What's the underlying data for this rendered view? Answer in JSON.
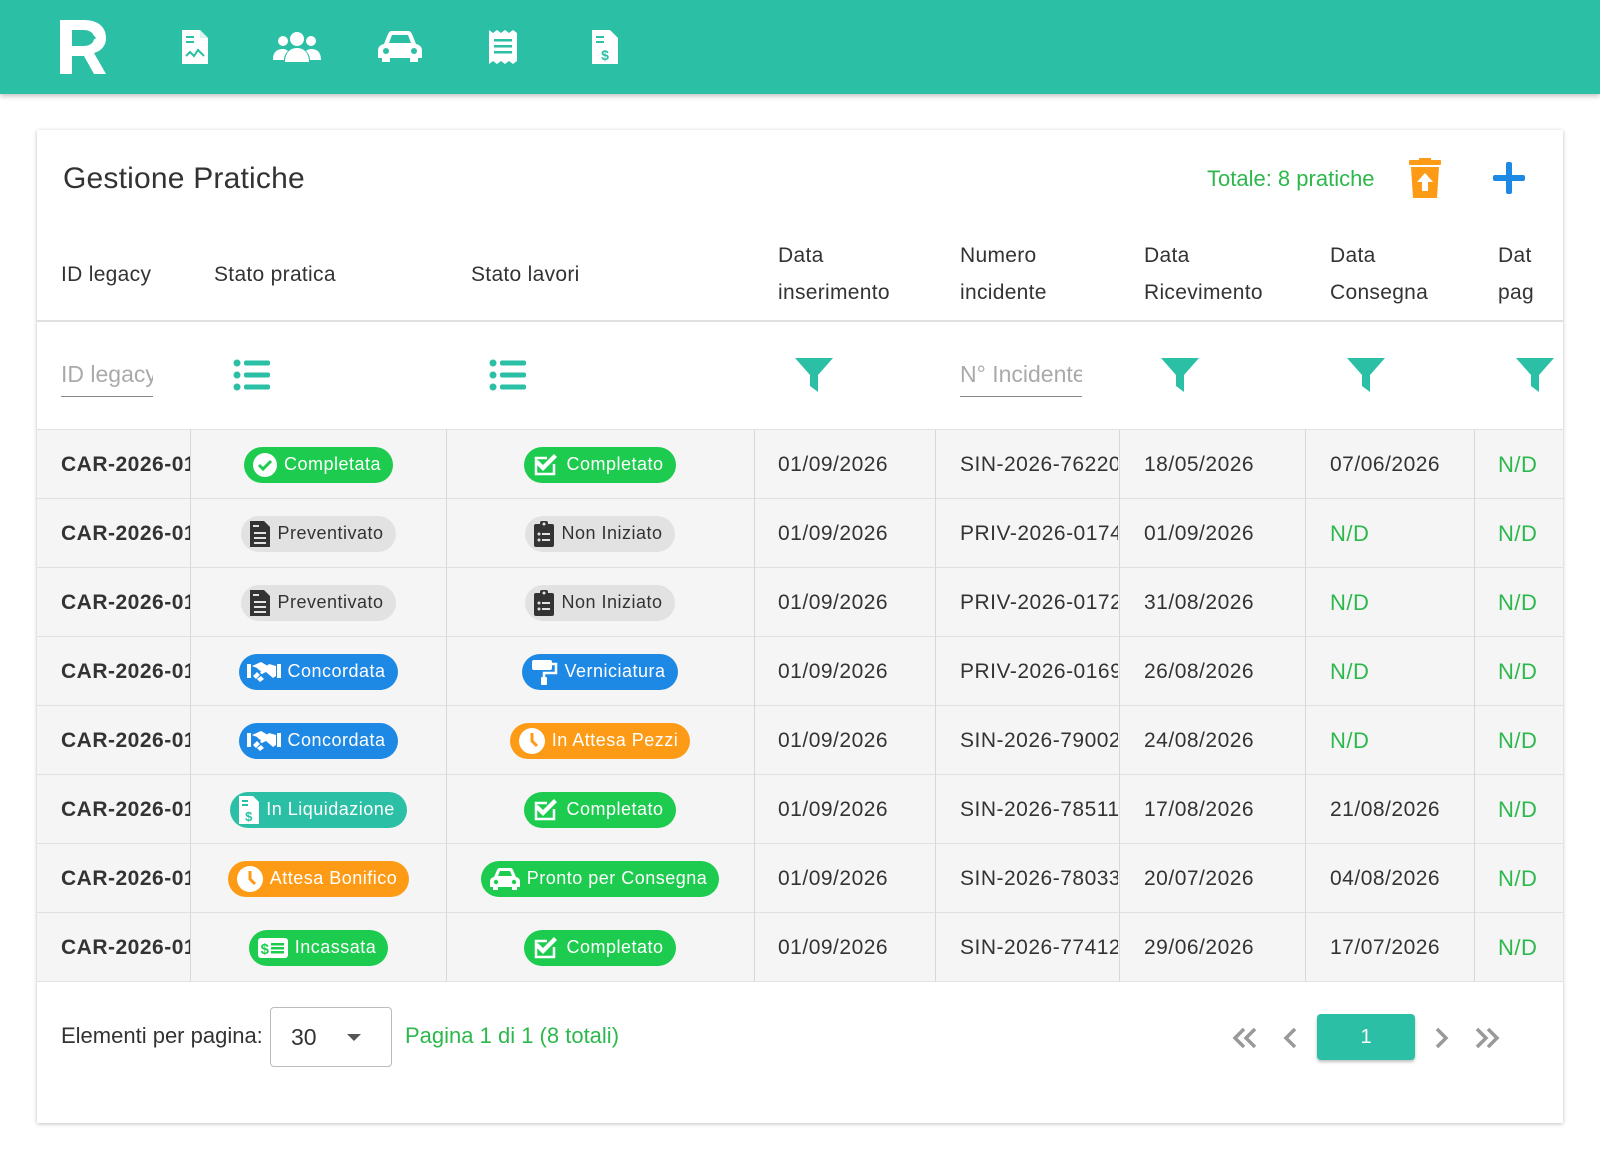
{
  "nav": {
    "items": [
      "documents-icon",
      "clients-icon",
      "vehicles-icon",
      "receipts-icon",
      "invoices-icon"
    ]
  },
  "header": {
    "title": "Gestione Pratiche",
    "total": "Totale: 8 pratiche"
  },
  "columns": {
    "id_legacy": "ID legacy",
    "stato_pratica": "Stato pratica",
    "stato_lavori": "Stato lavori",
    "data_inserimento": "Data inserimento",
    "numero_incidente": "Numero incidente",
    "data_ricevimento": "Data Ricevimento",
    "data_consegna": "Data Consegna",
    "data_pagamento": "Data pag"
  },
  "filters": {
    "id_placeholder": "ID legacy",
    "incidente_placeholder": "N° Incidente"
  },
  "rows": [
    {
      "id": "CAR-2026-01",
      "pratica": "Completata",
      "pratica_kind": "green",
      "pratica_icon": "check-circle-icon",
      "lavori": "Completato",
      "lavori_kind": "green",
      "lavori_icon": "check-icon",
      "inserimento": "01/09/2026",
      "incidente": "SIN-2026-76220",
      "ricevimento": "18/05/2026",
      "consegna": "07/06/2026",
      "pagamento": "N/D"
    },
    {
      "id": "CAR-2026-01",
      "pratica": "Preventivato",
      "pratica_kind": "grey",
      "pratica_icon": "file-invoice-icon",
      "lavori": "Non Iniziato",
      "lavori_kind": "grey",
      "lavori_icon": "clipboard-icon",
      "inserimento": "01/09/2026",
      "incidente": "PRIV-2026-0174",
      "ricevimento": "01/09/2026",
      "consegna": "N/D",
      "pagamento": "N/D"
    },
    {
      "id": "CAR-2026-01",
      "pratica": "Preventivato",
      "pratica_kind": "grey",
      "pratica_icon": "file-invoice-icon",
      "lavori": "Non Iniziato",
      "lavori_kind": "grey",
      "lavori_icon": "clipboard-icon",
      "inserimento": "01/09/2026",
      "incidente": "PRIV-2026-0172",
      "ricevimento": "31/08/2026",
      "consegna": "N/D",
      "pagamento": "N/D"
    },
    {
      "id": "CAR-2026-01",
      "pratica": "Concordata",
      "pratica_kind": "blue",
      "pratica_icon": "handshake-icon",
      "lavori": "Verniciatura",
      "lavori_kind": "blue",
      "lavori_icon": "paint-roller-icon",
      "inserimento": "01/09/2026",
      "incidente": "PRIV-2026-0169",
      "ricevimento": "26/08/2026",
      "consegna": "N/D",
      "pagamento": "N/D"
    },
    {
      "id": "CAR-2026-01",
      "pratica": "Concordata",
      "pratica_kind": "blue",
      "pratica_icon": "handshake-icon",
      "lavori": "In Attesa Pezzi",
      "lavori_kind": "orange",
      "lavori_icon": "clock-icon",
      "inserimento": "01/09/2026",
      "incidente": "SIN-2026-79002",
      "ricevimento": "24/08/2026",
      "consegna": "N/D",
      "pagamento": "N/D"
    },
    {
      "id": "CAR-2026-01",
      "pratica": "In Liquidazione",
      "pratica_kind": "teal",
      "pratica_icon": "file-dollar-icon",
      "lavori": "Completato",
      "lavori_kind": "green",
      "lavori_icon": "check-icon",
      "inserimento": "01/09/2026",
      "incidente": "SIN-2026-78511",
      "ricevimento": "17/08/2026",
      "consegna": "21/08/2026",
      "pagamento": "N/D"
    },
    {
      "id": "CAR-2026-01",
      "pratica": "Attesa Bonifico",
      "pratica_kind": "orange",
      "pratica_icon": "clock-icon",
      "lavori": "Pronto per Consegna",
      "lavori_kind": "green",
      "lavori_icon": "car-icon",
      "inserimento": "01/09/2026",
      "incidente": "SIN-2026-78033",
      "ricevimento": "20/07/2026",
      "consegna": "04/08/2026",
      "pagamento": "N/D"
    },
    {
      "id": "CAR-2026-01",
      "pratica": "Incassata",
      "pratica_kind": "green",
      "pratica_icon": "money-bill-icon",
      "lavori": "Completato",
      "lavori_kind": "green",
      "lavori_icon": "check-icon",
      "inserimento": "01/09/2026",
      "incidente": "SIN-2026-77412",
      "ricevimento": "29/06/2026",
      "consegna": "17/07/2026",
      "pagamento": "N/D"
    }
  ],
  "footer": {
    "per_page_label": "Elementi per pagina:",
    "per_page_value": "30",
    "page_info": "Pagina 1 di 1 (8 totali)",
    "current_page": "1"
  },
  "colors": {
    "primary": "#2bbfa5",
    "green": "#1dcc4e",
    "blue": "#1e88e5",
    "orange": "#fe9b16",
    "text_green": "#2db84d"
  }
}
